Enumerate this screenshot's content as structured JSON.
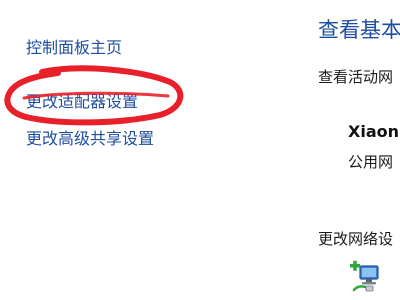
{
  "sidebar": {
    "items": [
      {
        "label": "控制面板主页"
      },
      {
        "label": "更改适配器设置"
      },
      {
        "label": "更改高级共享设置"
      }
    ]
  },
  "main": {
    "title": "查看基本",
    "active_networks_heading": "查看活动网",
    "network": {
      "name": "Xiaon",
      "type": "公用网"
    },
    "change_settings_heading": "更改网络设",
    "setup_icon": "network-setup-icon"
  },
  "annotation": {
    "color": "#e8202a"
  },
  "colors": {
    "link": "#1f4ea0",
    "text": "#1a1a1a"
  }
}
